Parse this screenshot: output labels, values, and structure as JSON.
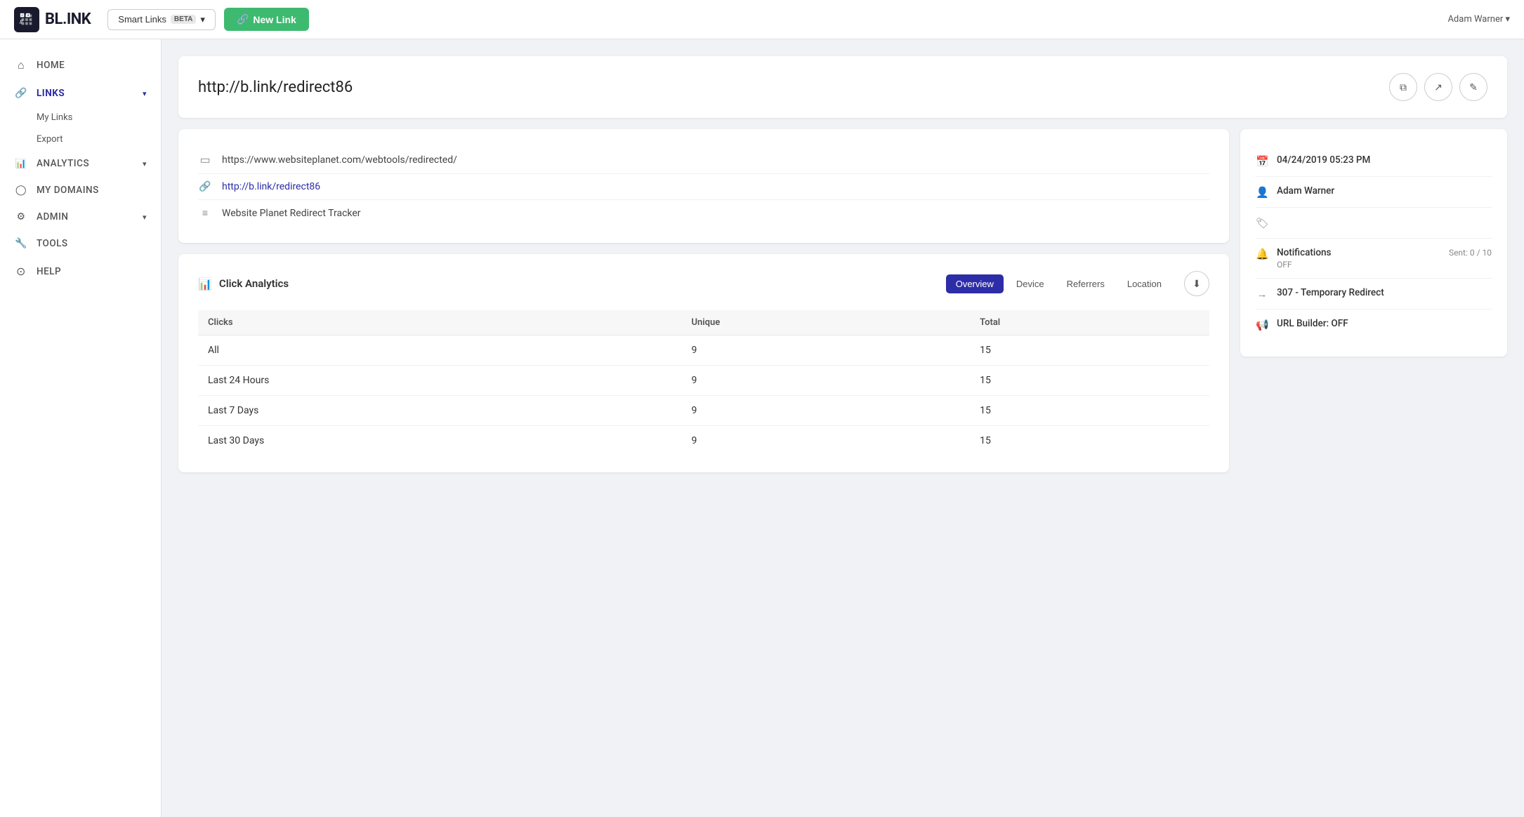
{
  "topnav": {
    "logo_text": "BL.INK",
    "smart_links_label": "Smart Links",
    "beta_badge": "BETA",
    "new_link_label": "New Link",
    "user_label": "Adam Warner ▾"
  },
  "sidebar": {
    "items": [
      {
        "id": "home",
        "label": "HOME",
        "icon": "⌂",
        "active": false
      },
      {
        "id": "links",
        "label": "LINKS",
        "icon": "🔗",
        "active": true,
        "has_chevron": true,
        "sub": [
          {
            "id": "my-links",
            "label": "My Links"
          },
          {
            "id": "export",
            "label": "Export"
          }
        ]
      },
      {
        "id": "analytics",
        "label": "ANALYTICS",
        "icon": "📊",
        "active": false,
        "has_chevron": true
      },
      {
        "id": "my-domains",
        "label": "MY DOMAINS",
        "icon": "○",
        "active": false
      },
      {
        "id": "admin",
        "label": "ADMIN",
        "icon": "⚙",
        "active": false,
        "has_chevron": true
      },
      {
        "id": "tools",
        "label": "TOOLS",
        "icon": "🔧",
        "active": false
      },
      {
        "id": "help",
        "label": "HELP",
        "icon": "?",
        "active": false
      }
    ]
  },
  "page": {
    "title": "http://b.link/redirect86",
    "link_info": {
      "destination_url": "https://www.websiteplanet.com/webtools/redirected/",
      "short_url": "http://b.link/redirect86",
      "title": "Website Planet Redirect Tracker"
    },
    "header_buttons": [
      {
        "id": "copy",
        "icon": "⧉",
        "label": "Copy"
      },
      {
        "id": "open",
        "icon": "↗",
        "label": "Open"
      },
      {
        "id": "edit",
        "icon": "✎",
        "label": "Edit"
      }
    ]
  },
  "analytics": {
    "title": "Click Analytics",
    "tabs": [
      {
        "id": "overview",
        "label": "Overview",
        "active": true
      },
      {
        "id": "device",
        "label": "Device",
        "active": false
      },
      {
        "id": "referrers",
        "label": "Referrers",
        "active": false
      },
      {
        "id": "location",
        "label": "Location",
        "active": false
      }
    ],
    "table": {
      "columns": [
        "Clicks",
        "Unique",
        "Total"
      ],
      "rows": [
        {
          "label": "All",
          "unique": 9,
          "total": 15
        },
        {
          "label": "Last 24 Hours",
          "unique": 9,
          "total": 15
        },
        {
          "label": "Last 7 Days",
          "unique": 9,
          "total": 15
        },
        {
          "label": "Last 30 Days",
          "unique": 9,
          "total": 15
        }
      ]
    }
  },
  "info_sidebar": {
    "created_date": "04/24/2019 05:23 PM",
    "owner": "Adam Warner",
    "tags": "",
    "notifications": {
      "label": "Notifications",
      "status": "OFF",
      "sent": "Sent: 0 / 10"
    },
    "redirect": "307 - Temporary Redirect",
    "url_builder": "URL Builder: OFF"
  }
}
